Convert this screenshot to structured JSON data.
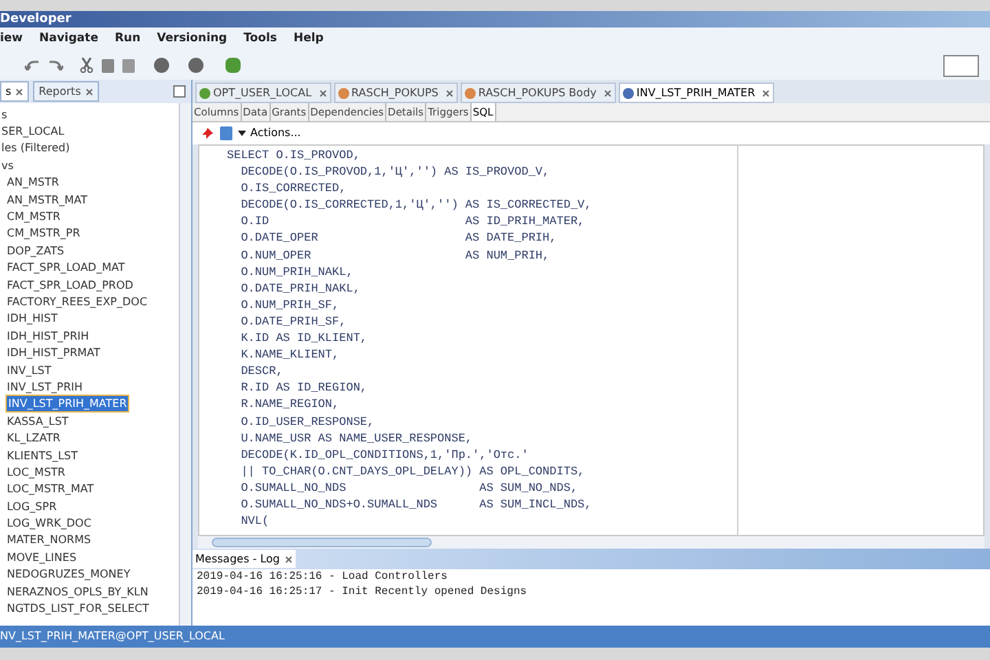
{
  "window": {
    "title": "Developer"
  },
  "menu": [
    "iew",
    "Navigate",
    "Run",
    "Versioning",
    "Tools",
    "Help"
  ],
  "left_tabs": [
    {
      "label": "s",
      "selected": true
    },
    {
      "label": "Reports",
      "selected": false
    }
  ],
  "tree": [
    {
      "label": "s",
      "children": [
        {
          "label": "SER_LOCAL",
          "children": [
            {
              "label": "les (Filtered)"
            },
            {
              "label": "vs",
              "children": [
                {
                  "label": "AN_MSTR",
                  "selected": false
                },
                {
                  "label": "AN_MSTR_MAT",
                  "selected": false
                },
                {
                  "label": "CM_MSTR",
                  "selected": false
                },
                {
                  "label": "CM_MSTR_PR",
                  "selected": false
                },
                {
                  "label": "DOP_ZATS",
                  "selected": false
                },
                {
                  "label": "FACT_SPR_LOAD_MAT",
                  "selected": false
                },
                {
                  "label": "FACT_SPR_LOAD_PROD",
                  "selected": false
                },
                {
                  "label": "FACTORY_REES_EXP_DOC",
                  "selected": false
                },
                {
                  "label": "IDH_HIST",
                  "selected": false
                },
                {
                  "label": "IDH_HIST_PRIH",
                  "selected": false
                },
                {
                  "label": "IDH_HIST_PRMAT",
                  "selected": false
                },
                {
                  "label": "INV_LST",
                  "selected": false
                },
                {
                  "label": "INV_LST_PRIH",
                  "selected": false
                },
                {
                  "label": "INV_LST_PRIH_MATER",
                  "selected": true
                },
                {
                  "label": "KASSA_LST",
                  "selected": false
                },
                {
                  "label": "KL_LZATR",
                  "selected": false
                },
                {
                  "label": "KLIENTS_LST",
                  "selected": false
                },
                {
                  "label": "LOC_MSTR",
                  "selected": false
                },
                {
                  "label": "LOC_MSTR_MAT",
                  "selected": false
                },
                {
                  "label": "LOG_SPR",
                  "selected": false
                },
                {
                  "label": "LOG_WRK_DOC",
                  "selected": false
                },
                {
                  "label": "MATER_NORMS",
                  "selected": false
                },
                {
                  "label": "MOVE_LINES",
                  "selected": false
                },
                {
                  "label": "NEDOGRUZES_MONEY",
                  "selected": false
                },
                {
                  "label": "NERAZNOS_OPLS_BY_KLN",
                  "selected": false
                },
                {
                  "label": "NGTDS_LIST_FOR_SELECT",
                  "selected": false
                }
              ]
            }
          ]
        }
      ]
    }
  ],
  "doc_tabs": [
    {
      "label": "OPT_USER_LOCAL",
      "kind": "connection",
      "selected": false
    },
    {
      "label": "RASCH_POKUPS",
      "kind": "package",
      "selected": false
    },
    {
      "label": "RASCH_POKUPS Body",
      "kind": "package",
      "selected": false
    },
    {
      "label": "INV_LST_PRIH_MATER",
      "kind": "view",
      "selected": true
    }
  ],
  "sub_tabs": [
    {
      "label": "Columns",
      "selected": false
    },
    {
      "label": "Data",
      "selected": false
    },
    {
      "label": "Grants",
      "selected": false
    },
    {
      "label": "Dependencies",
      "selected": false
    },
    {
      "label": "Details",
      "selected": false
    },
    {
      "label": "Triggers",
      "selected": false
    },
    {
      "label": "SQL",
      "selected": true
    }
  ],
  "actions_label": "Actions...",
  "sql_lines": [
    "SELECT O.IS_PROVOD,",
    "  DECODE(O.IS_PROVOD,1,'Ц','') AS IS_PROVOD_V,",
    "  O.IS_CORRECTED,",
    "  DECODE(O.IS_CORRECTED,1,'Ц','') AS IS_CORRECTED_V,",
    "  O.ID                            AS ID_PRIH_MATER,",
    "  O.DATE_OPER                     AS DATE_PRIH,",
    "  O.NUM_OPER                      AS NUM_PRIH,",
    "  O.NUM_PRIH_NAKL,",
    "  O.DATE_PRIH_NAKL,",
    "  O.NUM_PRIH_SF,",
    "  O.DATE_PRIH_SF,",
    "  K.ID AS ID_KLIENT,",
    "  K.NAME_KLIENT,",
    "  DESCR,",
    "  R.ID AS ID_REGION,",
    "  R.NAME_REGION,",
    "  O.ID_USER_RESPONSE,",
    "  U.NAME_USR AS NAME_USER_RESPONSE,",
    "  DECODE(K.ID_OPL_CONDITIONS,1,'Пр.','Отс.'",
    "  || TO_CHAR(O.CNT_DAYS_OPL_DELAY)) AS OPL_CONDITS,",
    "  O.SUMALL_NO_NDS                   AS SUM_NO_NDS,",
    "  O.SUMALL_NO_NDS+O.SUMALL_NDS      AS SUM_INCL_NDS,",
    "  NVL("
  ],
  "messages": {
    "title": "Messages - Log",
    "lines": [
      "2019-04-16 16:25:16 - Load Controllers",
      "2019-04-16 16:25:17 - Init Recently opened Designs"
    ]
  },
  "status_bar": "NV_LST_PRIH_MATER@OPT_USER_LOCAL"
}
